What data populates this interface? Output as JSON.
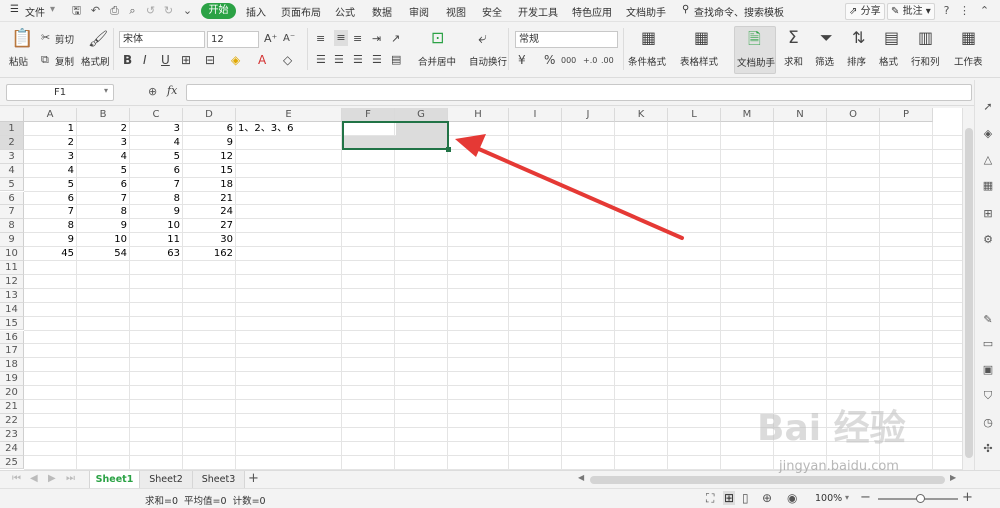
{
  "menubar": {
    "file": "文件",
    "tabs": [
      "开始",
      "插入",
      "页面布局",
      "公式",
      "数据",
      "审阅",
      "视图",
      "安全",
      "开发工具",
      "特色应用",
      "文档助手"
    ],
    "search": "查找命令、搜索模板",
    "share": "分享",
    "comment": "批注"
  },
  "ribbon": {
    "paste": "粘贴",
    "cut": "剪切",
    "copy": "复制",
    "format_painter": "格式刷",
    "font_name": "宋体",
    "font_size": "12",
    "merge_center": "合并居中",
    "wrap_text": "自动换行",
    "number_format": "常规",
    "percent": "%",
    "thousands": "000",
    "cond_format": "条件格式",
    "table_style": "表格样式",
    "doc_assist": "文档助手",
    "sum": "求和",
    "filter": "筛选",
    "sort": "排序",
    "format": "格式",
    "rowcol": "行和列",
    "sheet": "工作表"
  },
  "formula_bar": {
    "name_box": "F1",
    "fx": "fx",
    "value": ""
  },
  "grid": {
    "columns": [
      "A",
      "B",
      "C",
      "D",
      "E",
      "F",
      "G",
      "H",
      "I",
      "J",
      "K",
      "L",
      "M",
      "N",
      "O",
      "P"
    ],
    "selected_columns": [
      "F",
      "G"
    ],
    "rows": [
      "1",
      "2",
      "3",
      "4",
      "5",
      "6",
      "7",
      "8",
      "9",
      "10",
      "11",
      "12",
      "13",
      "14",
      "15",
      "16",
      "17",
      "18",
      "19",
      "20",
      "21",
      "22",
      "23",
      "24",
      "25"
    ],
    "selected_rows": [
      "1",
      "2"
    ],
    "data": [
      [
        "1",
        "2",
        "3",
        "6",
        "1、2、3、6"
      ],
      [
        "2",
        "3",
        "4",
        "9"
      ],
      [
        "3",
        "4",
        "5",
        "12"
      ],
      [
        "4",
        "5",
        "6",
        "15"
      ],
      [
        "5",
        "6",
        "7",
        "18"
      ],
      [
        "6",
        "7",
        "8",
        "21"
      ],
      [
        "7",
        "8",
        "9",
        "24"
      ],
      [
        "8",
        "9",
        "10",
        "27"
      ],
      [
        "9",
        "10",
        "11",
        "30"
      ],
      [
        "45",
        "54",
        "63",
        "162"
      ]
    ]
  },
  "sheets": {
    "tabs": [
      "Sheet1",
      "Sheet2",
      "Sheet3"
    ],
    "active": "Sheet1",
    "add": "+"
  },
  "status": {
    "text": "求和=0  平均值=0  计数=0",
    "zoom": "100%"
  },
  "watermark": {
    "logo": "Bai 经验",
    "url": "jingyan.baidu.com"
  },
  "colors": {
    "accent": "#2ba245",
    "selection": "#217346",
    "arrow": "#e53935"
  }
}
